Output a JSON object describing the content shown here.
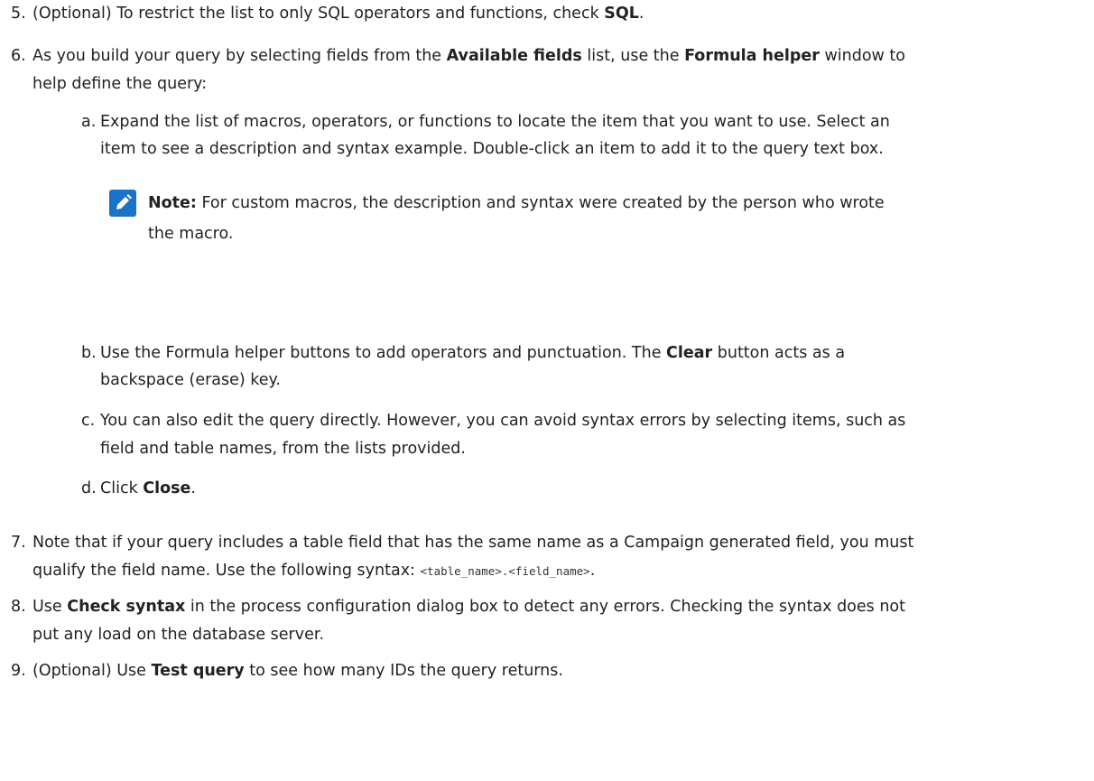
{
  "steps": {
    "s5": {
      "num": "5.",
      "pre": "(Optional) To restrict the list to only SQL operators and functions, check ",
      "bold": "SQL",
      "post": "."
    },
    "s6": {
      "num": "6.",
      "pre": "As you build your query by selecting fields from the ",
      "bold1": "Available fields",
      "mid": " list, use the ",
      "bold2": "Formula helper",
      "post": " window to",
      "line2": "help define the query:"
    },
    "a": {
      "num": "a.",
      "line1": "Expand the list of macros, operators, or functions to locate the item that you want to use. Select an",
      "line2": "item to see a description and syntax example. Double-click an item to add it to the query text box."
    },
    "note": {
      "icon": "pencil-icon",
      "label": "Note:",
      "line1": " For custom macros, the description and syntax were created by the person who wrote",
      "line2": "the macro."
    },
    "b": {
      "num": "b.",
      "pre": "Use the Formula helper buttons to add operators and punctuation. The ",
      "bold": "Clear",
      "post": " button acts as a",
      "line2": "backspace (erase) key."
    },
    "c": {
      "num": "c.",
      "line1": "You can also edit the query directly. However, you can avoid syntax errors by selecting items, such as",
      "line2": "field and table names, from the lists provided."
    },
    "d": {
      "num": "d.",
      "pre": "Click ",
      "bold": "Close",
      "post": "."
    },
    "s7": {
      "num": "7.",
      "line1": "Note that if your query includes a table field that has the same name as a Campaign generated field, you must",
      "pre2": "qualify the field name. Use the following syntax: ",
      "code": "<table_name>.<field_name>",
      "post2": "."
    },
    "s8": {
      "num": "8.",
      "pre": "Use ",
      "bold": "Check syntax",
      "post": " in the process configuration dialog box to detect any errors. Checking the syntax does not",
      "line2": "put any load on the database server."
    },
    "s9": {
      "num": "9.",
      "pre": "(Optional) Use ",
      "bold": "Test query",
      "post": " to see how many IDs the query returns."
    }
  },
  "colors": {
    "text": "#222222",
    "note_icon_bg": "#1a73c6"
  }
}
